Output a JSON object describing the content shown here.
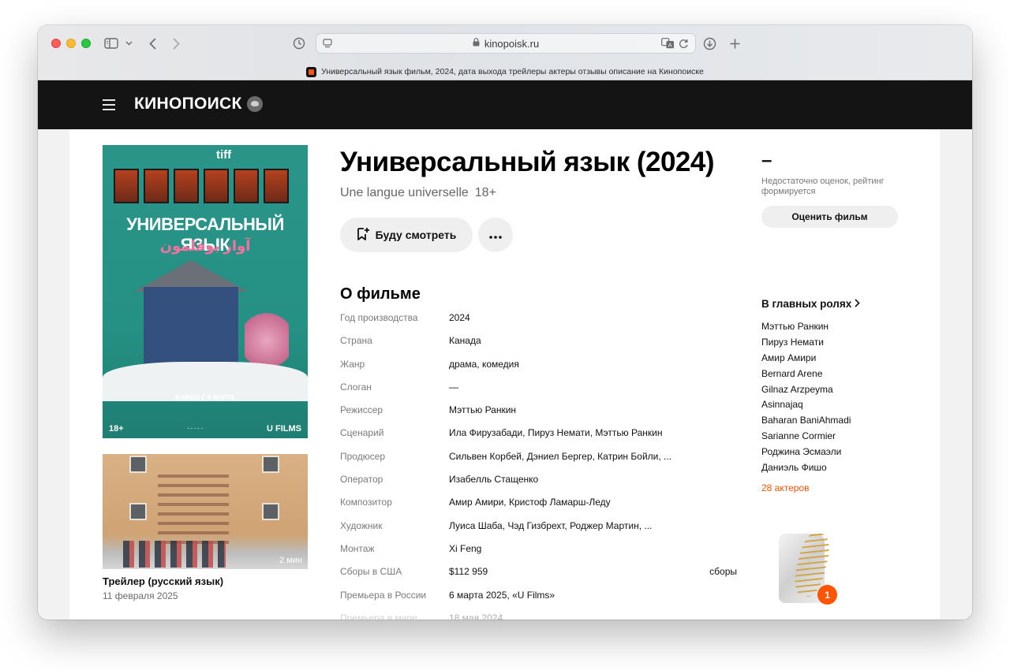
{
  "browser": {
    "url": "kinopoisk.ru",
    "tab_title": "Универсальный язык фильм, 2024, дата выхода трейлеры актеры отзывы описание на Кинопоиске",
    "icons": [
      "sidebar-icon",
      "chevron-down-icon",
      "back-icon",
      "forward-icon",
      "history-icon",
      "page-settings-icon",
      "lock-icon",
      "translate-icon",
      "reload-icon",
      "download-icon",
      "plus-icon"
    ]
  },
  "header": {
    "logo": "КИНОПОИСК"
  },
  "poster": {
    "festival": "tiff",
    "title": "УНИВЕРСАЛЬНЫЙ ЯЗЫК",
    "subtitle": "آواز بوقلمون",
    "release": "В КИНО С 6 МАРТА",
    "age": "18+",
    "distributor": "U FILMS"
  },
  "trailer": {
    "duration": "2 мин",
    "title": "Трейлер (русский язык)",
    "date": "11 февраля 2025"
  },
  "film": {
    "title": "Универсальный язык (2024)",
    "original_title": "Une langue universelle",
    "age": "18+",
    "watch_label": "Буду смотреть"
  },
  "about": {
    "title": "О фильме",
    "rows": [
      {
        "label": "Год производства",
        "value": "2024"
      },
      {
        "label": "Страна",
        "value": "Канада"
      },
      {
        "label": "Жанр",
        "value": "драма, комедия"
      },
      {
        "label": "Слоган",
        "value": "—"
      },
      {
        "label": "Режиссер",
        "value": "Мэттью Ранкин"
      },
      {
        "label": "Сценарий",
        "value": "Ила Фирузабади, Пируз Немати, Мэттью Ранкин"
      },
      {
        "label": "Продюсер",
        "value": "Сильвен Корбей, Дэниел Бергер, Катрин Бойли, ..."
      },
      {
        "label": "Оператор",
        "value": "Изабелль Стащенко"
      },
      {
        "label": "Композитор",
        "value": "Амир Амири, Кристоф Ламарш-Леду"
      },
      {
        "label": "Художник",
        "value": "Луиса Шаба, Чэд Гизбрехт, Роджер Мартин, ..."
      },
      {
        "label": "Монтаж",
        "value": "Xi Feng"
      },
      {
        "label": "Сборы в США",
        "value": "$112 959",
        "extra": "сборы"
      },
      {
        "label": "Премьера в России",
        "value": "6 марта 2025, «U Films»"
      },
      {
        "label": "Премьера в мире",
        "value": "18 мая 2024"
      }
    ]
  },
  "rating": {
    "value": "–",
    "note": "Недостаточно оценок, рейтинг формируется",
    "rate_label": "Оценить фильм"
  },
  "cast": {
    "title": "В главных ролях",
    "actors": [
      "Мэттью Ранкин",
      "Пируз Немати",
      "Амир Амири",
      "Bernard Arene",
      "Gilnaz Arzpeyma",
      "Asinnajaq",
      "Baharan BaniAhmadi",
      "Sarianne Cormier",
      "Роджина Эсмаэли",
      "Даниэль Фишо"
    ],
    "count": "28 актеров"
  },
  "award": {
    "count": "1"
  }
}
